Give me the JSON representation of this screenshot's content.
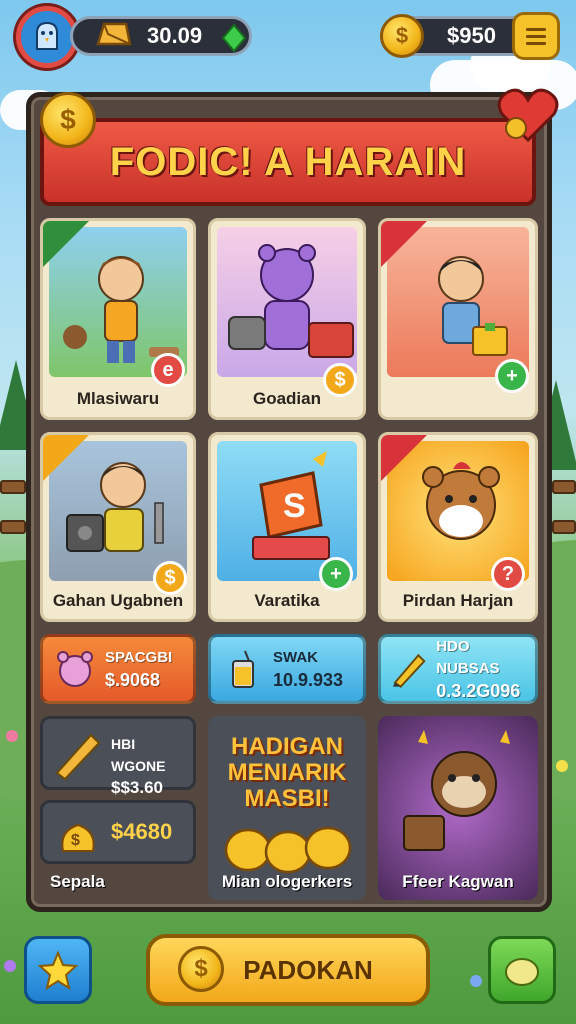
{
  "topbar": {
    "gold_value": "30.09",
    "coin_value": "$950"
  },
  "banner": {
    "title": "FODIC!  A HARAIN"
  },
  "cards": [
    {
      "label": "Mlasiwaru",
      "badge": "e"
    },
    {
      "label": "Goadian",
      "badge": "$"
    },
    {
      "label": "",
      "badge": "+"
    },
    {
      "label": "Gahan Ugabnen",
      "badge": "$"
    },
    {
      "label": "Varatika",
      "badge": "+"
    },
    {
      "label": "Pirdan Harjan",
      "badge": "?"
    }
  ],
  "offers": [
    {
      "line1": "SPACGBI",
      "line2": "$.9068"
    },
    {
      "line1": "SWAK",
      "line2": "10.9.933"
    },
    {
      "line1": "HDO NUBSAS",
      "line2": "0.3.2G096"
    }
  ],
  "left_tiles": [
    {
      "line1": "HBI WGONE",
      "line2": "$$3.60"
    },
    {
      "line1": "$4680",
      "line2": ""
    }
  ],
  "promo": {
    "text": "HADIGAN MENIARIK MASBI!"
  },
  "bottom_labels": {
    "left": "Sepala",
    "middle": "Mian ologerkers",
    "right": "Ffeer Kagwan"
  },
  "bottom_bar": {
    "main_button": "PADOKAN"
  },
  "colors": {
    "banner": "#d9392e",
    "title": "#ffd24a",
    "board": "#54473f",
    "primary_button": "#f6b52a"
  }
}
